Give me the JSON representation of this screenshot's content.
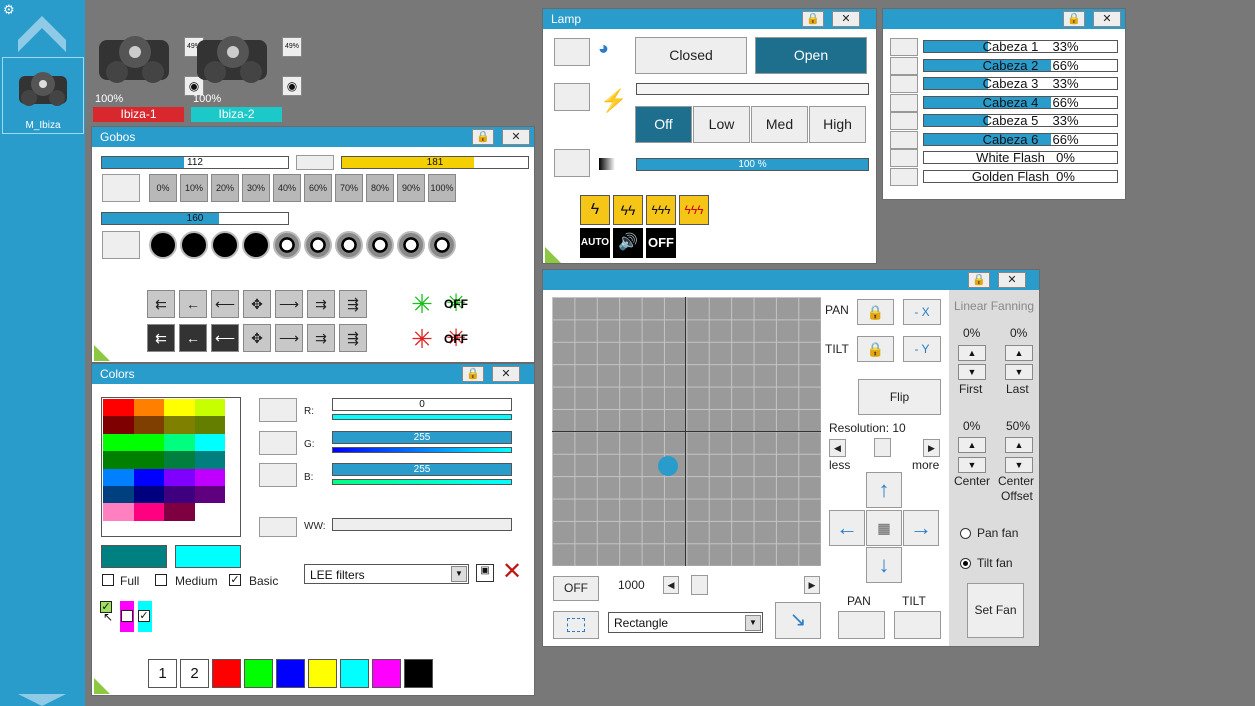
{
  "sidebar": {
    "fixture_label": "M_Ibiza"
  },
  "fixtures": [
    {
      "percent": "100%",
      "name": "Ibiza-1",
      "color": "#d8282e",
      "badge": "49%"
    },
    {
      "percent": "100%",
      "name": "Ibiza-2",
      "color": "#1bc9c9",
      "badge": "49%"
    }
  ],
  "gobos": {
    "title": "Gobos",
    "bar1": {
      "value": "112",
      "level": 0.44
    },
    "bar2": {
      "value": "181",
      "level": 0.71,
      "color": "#f5d000"
    },
    "bar3": {
      "value": "160",
      "level": 0.63
    },
    "percents": [
      "0%",
      "10%",
      "20%",
      "30%",
      "40%",
      "60%",
      "70%",
      "80%",
      "90%",
      "100%"
    ],
    "off1": "OFF",
    "off2": "OFF"
  },
  "colors": {
    "title": "Colors",
    "palette": [
      "#ff0000",
      "#ff7f00",
      "#ffff00",
      "#c8ff00",
      "#7f0000",
      "#7f3f00",
      "#7f7f00",
      "#647f00",
      "#00ff00",
      "#00ff00",
      "#00ff7f",
      "#00ffff",
      "#007f00",
      "#007f00",
      "#007f3f",
      "#007f7f",
      "#0080ff",
      "#0000ff",
      "#7f00ff",
      "#bf00ff",
      "#00407f",
      "#00007f",
      "#3f007f",
      "#5f007f",
      "#ff80c0",
      "#ff0080",
      "#7f0040",
      "#ffffff"
    ],
    "r_label": "R:",
    "r_value": "0",
    "r_level": 0.0,
    "g_label": "G:",
    "g_value": "255",
    "g_level": 1.0,
    "b_label": "B:",
    "b_value": "255",
    "b_level": 1.0,
    "ww_label": "WW:",
    "swatch_current": "#008080",
    "swatch_target": "#00ffff",
    "opt_full": "Full",
    "opt_medium": "Medium",
    "opt_basic": "Basic",
    "filter_select": "LEE filters",
    "preset_1": "1",
    "preset_2": "2",
    "presets": [
      "#ff0000",
      "#00ff00",
      "#0000ff",
      "#ffff00",
      "#00ffff",
      "#ff00ff",
      "#000000"
    ]
  },
  "lamp": {
    "title": "Lamp",
    "closed": "Closed",
    "open": "Open",
    "off": "Off",
    "low": "Low",
    "med": "Med",
    "high": "High",
    "dimmer_value": "100 %",
    "dimmer_level": 1.0,
    "auto": "AUTO",
    "strobe_off": "OFF"
  },
  "heads": {
    "rows": [
      {
        "label": "Cabeza 1",
        "value": "33%",
        "level": 0.33
      },
      {
        "label": "Cabeza 2",
        "value": "66%",
        "level": 0.66
      },
      {
        "label": "Cabeza 3",
        "value": "33%",
        "level": 0.33
      },
      {
        "label": "Cabeza 4",
        "value": "66%",
        "level": 0.66
      },
      {
        "label": "Cabeza 5",
        "value": "33%",
        "level": 0.33
      },
      {
        "label": "Cabeza 6",
        "value": "66%",
        "level": 0.66
      },
      {
        "label": "White Flash",
        "value": "0%",
        "level": 0.0
      },
      {
        "label": "Golden Flash",
        "value": "0%",
        "level": 0.0
      }
    ]
  },
  "position": {
    "pan": "PAN",
    "tilt": "TILT",
    "minus_x": "- X",
    "minus_y": "- Y",
    "flip": "Flip",
    "resolution": "Resolution: 10",
    "less": "less",
    "more": "more",
    "off": "OFF",
    "speed": "1000",
    "shape_select": "Rectangle",
    "pan_bottom": "PAN",
    "tilt_bottom": "TILT",
    "fanning_title": "Linear Fanning",
    "first_pct": "0%",
    "last_pct": "0%",
    "first": "First",
    "last": "Last",
    "center_pct": "0%",
    "offset_pct": "50%",
    "center": "Center",
    "center_offset_1": "Center",
    "center_offset_2": "Offset",
    "pan_fan": "Pan fan",
    "tilt_fan": "Tilt fan",
    "set_fan": "Set Fan"
  }
}
